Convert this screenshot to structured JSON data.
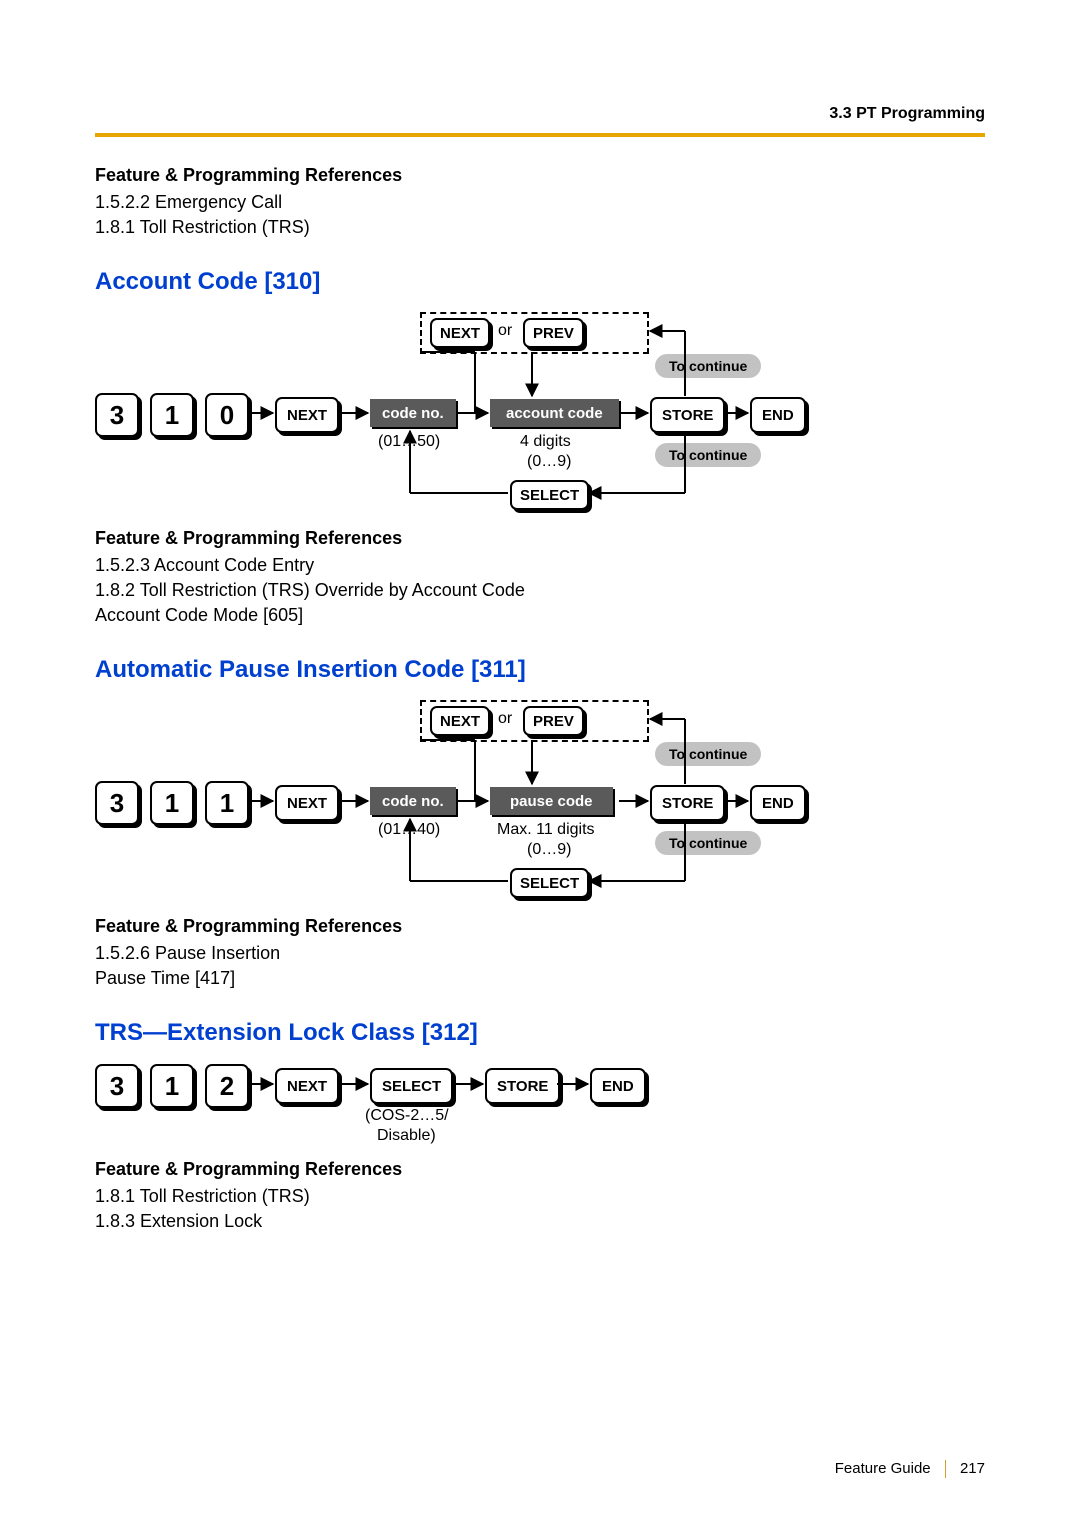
{
  "header": {
    "section": "3.3 PT Programming"
  },
  "intro_refs": {
    "title": "Feature & Programming References",
    "items": [
      "1.5.2.2 Emergency Call",
      "1.8.1 Toll Restriction (TRS)"
    ]
  },
  "s310": {
    "title": "Account Code [310]",
    "digits": [
      "3",
      "1",
      "0"
    ],
    "next": "NEXT",
    "nav_next": "NEXT",
    "nav_or": "or",
    "nav_prev": "PREV",
    "code_no": "code no.",
    "code_no_range": "(01…50)",
    "value_label": "account code",
    "value_sub1": "4 digits",
    "value_sub2": "(0…9)",
    "store": "STORE",
    "end": "END",
    "select": "SELECT",
    "to_continue": "To continue",
    "refs_title": "Feature & Programming References",
    "refs": [
      "1.5.2.3 Account Code Entry",
      "1.8.2 Toll Restriction (TRS) Override by Account Code",
      "Account Code Mode [605]"
    ]
  },
  "s311": {
    "title": "Automatic Pause Insertion Code [311]",
    "digits": [
      "3",
      "1",
      "1"
    ],
    "next": "NEXT",
    "nav_next": "NEXT",
    "nav_or": "or",
    "nav_prev": "PREV",
    "code_no": "code no.",
    "code_no_range": "(01…40)",
    "value_label": "pause code",
    "value_sub1": "Max. 11 digits",
    "value_sub2": "(0…9)",
    "store": "STORE",
    "end": "END",
    "select": "SELECT",
    "to_continue": "To continue",
    "refs_title": "Feature & Programming References",
    "refs": [
      "1.5.2.6 Pause Insertion",
      "Pause Time [417]"
    ]
  },
  "s312": {
    "title": "TRS—Extension Lock Class [312]",
    "digits": [
      "3",
      "1",
      "2"
    ],
    "next": "NEXT",
    "select": "SELECT",
    "select_sub1": "(COS-2…5/",
    "select_sub2": "Disable)",
    "store": "STORE",
    "end": "END",
    "refs_title": "Feature & Programming References",
    "refs": [
      "1.8.1 Toll Restriction (TRS)",
      "1.8.3 Extension Lock"
    ]
  },
  "footer": {
    "guide": "Feature Guide",
    "page": "217"
  }
}
